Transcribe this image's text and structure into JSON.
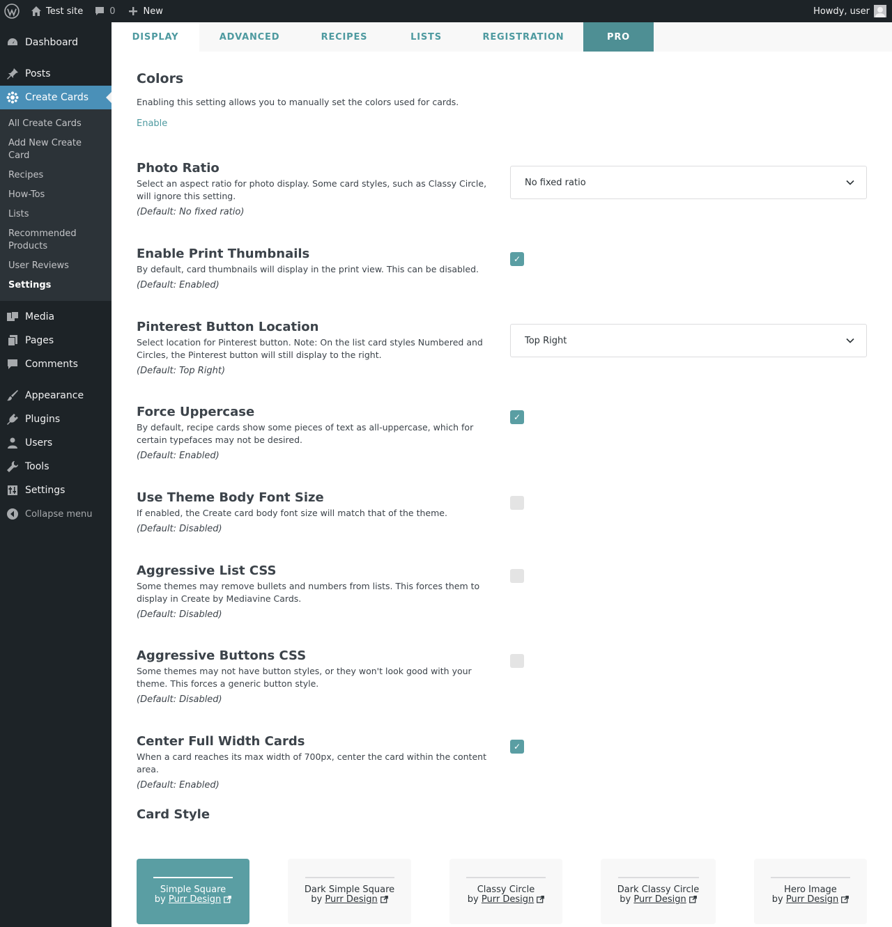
{
  "adminbar": {
    "site_name": "Test site",
    "comments_count": "0",
    "new_label": "New",
    "howdy": "Howdy, user"
  },
  "sidebar": {
    "dashboard": "Dashboard",
    "posts": "Posts",
    "create_cards": "Create Cards",
    "submenu": [
      "All Create Cards",
      "Add New Create Card",
      "Recipes",
      "How-Tos",
      "Lists",
      "Recommended Products",
      "User Reviews",
      "Settings"
    ],
    "media": "Media",
    "pages": "Pages",
    "comments": "Comments",
    "appearance": "Appearance",
    "plugins": "Plugins",
    "users": "Users",
    "tools": "Tools",
    "settings": "Settings",
    "collapse": "Collapse menu"
  },
  "tabs": [
    "DISPLAY",
    "ADVANCED",
    "RECIPES",
    "LISTS",
    "REGISTRATION",
    "PRO"
  ],
  "colors": {
    "title": "Colors",
    "description": "Enabling this setting allows you to manually set the colors used for cards.",
    "enable_link": "Enable"
  },
  "settings": [
    {
      "title": "Photo Ratio",
      "description": "Select an aspect ratio for photo display. Some card styles, such as Classy Circle, will ignore this setting.",
      "default": "(Default: No fixed ratio)",
      "type": "select",
      "value": "No fixed ratio"
    },
    {
      "title": "Enable Print Thumbnails",
      "description": "By default, card thumbnails will display in the print view. This can be disabled.",
      "default": "(Default: Enabled)",
      "type": "checkbox",
      "checked": true
    },
    {
      "title": "Pinterest Button Location",
      "description": "Select location for Pinterest button. Note: On the list card styles Numbered and Circles, the Pinterest button will still display to the right.",
      "default": "(Default: Top Right)",
      "type": "select",
      "value": "Top Right"
    },
    {
      "title": "Force Uppercase",
      "description": "By default, recipe cards show some pieces of text as all-uppercase, which for certain typefaces may not be desired.",
      "default": "(Default: Enabled)",
      "type": "checkbox",
      "checked": true
    },
    {
      "title": "Use Theme Body Font Size",
      "description": "If enabled, the Create card body font size will match that of the theme.",
      "default": "(Default: Disabled)",
      "type": "checkbox",
      "checked": false
    },
    {
      "title": "Aggressive List CSS",
      "description": "Some themes may remove bullets and numbers from lists. This forces them to display in Create by Mediavine Cards.",
      "default": "(Default: Disabled)",
      "type": "checkbox",
      "checked": false
    },
    {
      "title": "Aggressive Buttons CSS",
      "description": "Some themes may not have button styles, or they won't look good with your theme. This forces a generic button style.",
      "default": "(Default: Disabled)",
      "type": "checkbox",
      "checked": false
    },
    {
      "title": "Center Full Width Cards",
      "description": "When a card reaches its max width of 700px, center the card within the content area.",
      "default": "(Default: Enabled)",
      "type": "checkbox",
      "checked": true
    }
  ],
  "card_style": {
    "title": "Card Style",
    "by_label": "by",
    "designer": "Purr Design",
    "styles": [
      "Simple Square",
      "Dark Simple Square",
      "Classy Circle",
      "Dark Classy Circle",
      "Hero Image"
    ],
    "selected": "Simple Square"
  },
  "check_glyph": "✓",
  "accent_color": "#5a9ea3"
}
